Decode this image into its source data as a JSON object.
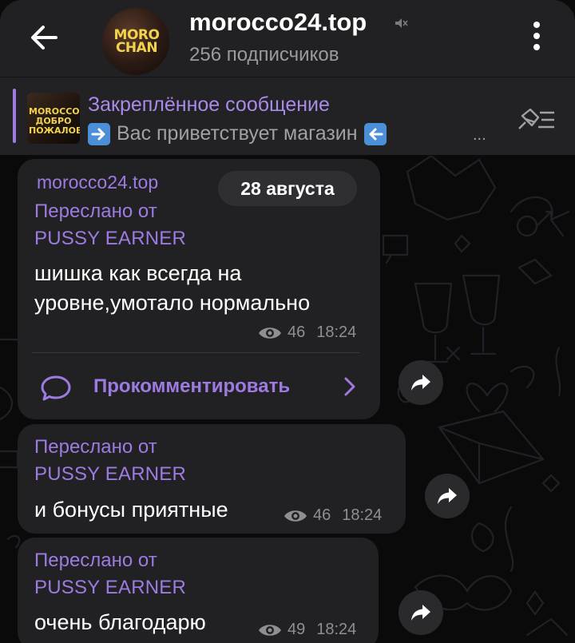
{
  "header": {
    "title": "morocco24.top",
    "subscribers": "256 подписчиков",
    "avatar_text": "MORO CHAN",
    "icons": [
      "back-arrow-icon",
      "mute-icon",
      "more-vertical-icon"
    ]
  },
  "pinned": {
    "title": "Закреплённое сообщение",
    "text": "Вас приветствует магазин",
    "ellipsis": "...",
    "thumb_text": "MOROCCO ДОБРО ПОЖАЛОВАТЬ",
    "icons": [
      "right-arrow-emoji-icon",
      "left-arrow-emoji-icon",
      "pin-list-icon"
    ]
  },
  "messages": [
    {
      "channel": "morocco24.top",
      "date_chip": "28 августа",
      "forwarded_label": "Переслано от",
      "forwarded_from": "PUSSY EARNER",
      "text_line1": "шишка как всегда на",
      "text_line2": "уровне,умотало нормально",
      "views": "46",
      "time": "18:24",
      "comment_label": "Прокомментировать"
    },
    {
      "forwarded_label": "Переслано от",
      "forwarded_from": "PUSSY EARNER",
      "text": "и бонусы приятные",
      "views": "46",
      "time": "18:24"
    },
    {
      "forwarded_label": "Переслано от",
      "forwarded_from": "PUSSY EARNER",
      "text": "очень благодарю",
      "views": "49",
      "time": "18:24"
    }
  ],
  "colors": {
    "accent": "#9d7be0",
    "bubble": "#212124",
    "header": "#212123",
    "background": "#0a0a0b",
    "meta": "#8e8e94"
  }
}
